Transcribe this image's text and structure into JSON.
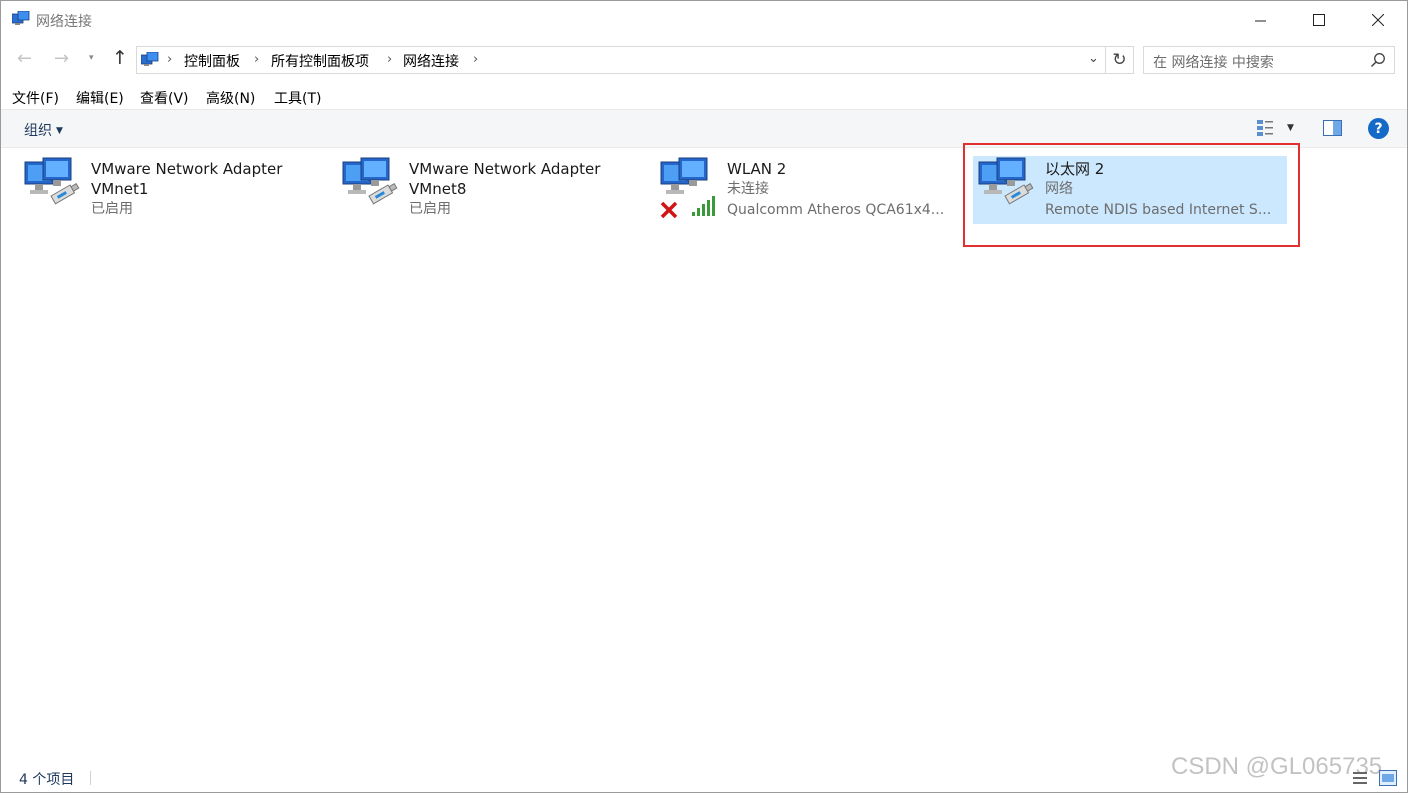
{
  "window": {
    "title": "网络连接"
  },
  "address": {
    "crumbs": [
      "控制面板",
      "所有控制面板项",
      "网络连接"
    ]
  },
  "search": {
    "placeholder": "在 网络连接 中搜索"
  },
  "menu": {
    "items": [
      "文件(F)",
      "编辑(E)",
      "查看(V)",
      "高级(N)",
      "工具(T)"
    ]
  },
  "commandbar": {
    "organize": "组织"
  },
  "connections": [
    {
      "name": "VMware Network Adapter",
      "name2": "VMnet1",
      "status": "已启用",
      "device": ""
    },
    {
      "name": "VMware Network Adapter",
      "name2": "VMnet8",
      "status": "已启用",
      "device": ""
    },
    {
      "name": "WLAN 2",
      "name2": "",
      "status": "未连接",
      "device": "Qualcomm Atheros QCA61x4..."
    },
    {
      "name": "以太网 2",
      "name2": "",
      "status": "网络",
      "device": "Remote NDIS based Internet S..."
    }
  ],
  "statusbar": {
    "count": "4 个项目"
  },
  "watermark": "CSDN @GL065735",
  "colors": {
    "selection": "#cce8ff",
    "highlight_border": "#e03030",
    "help": "#1569c7"
  }
}
